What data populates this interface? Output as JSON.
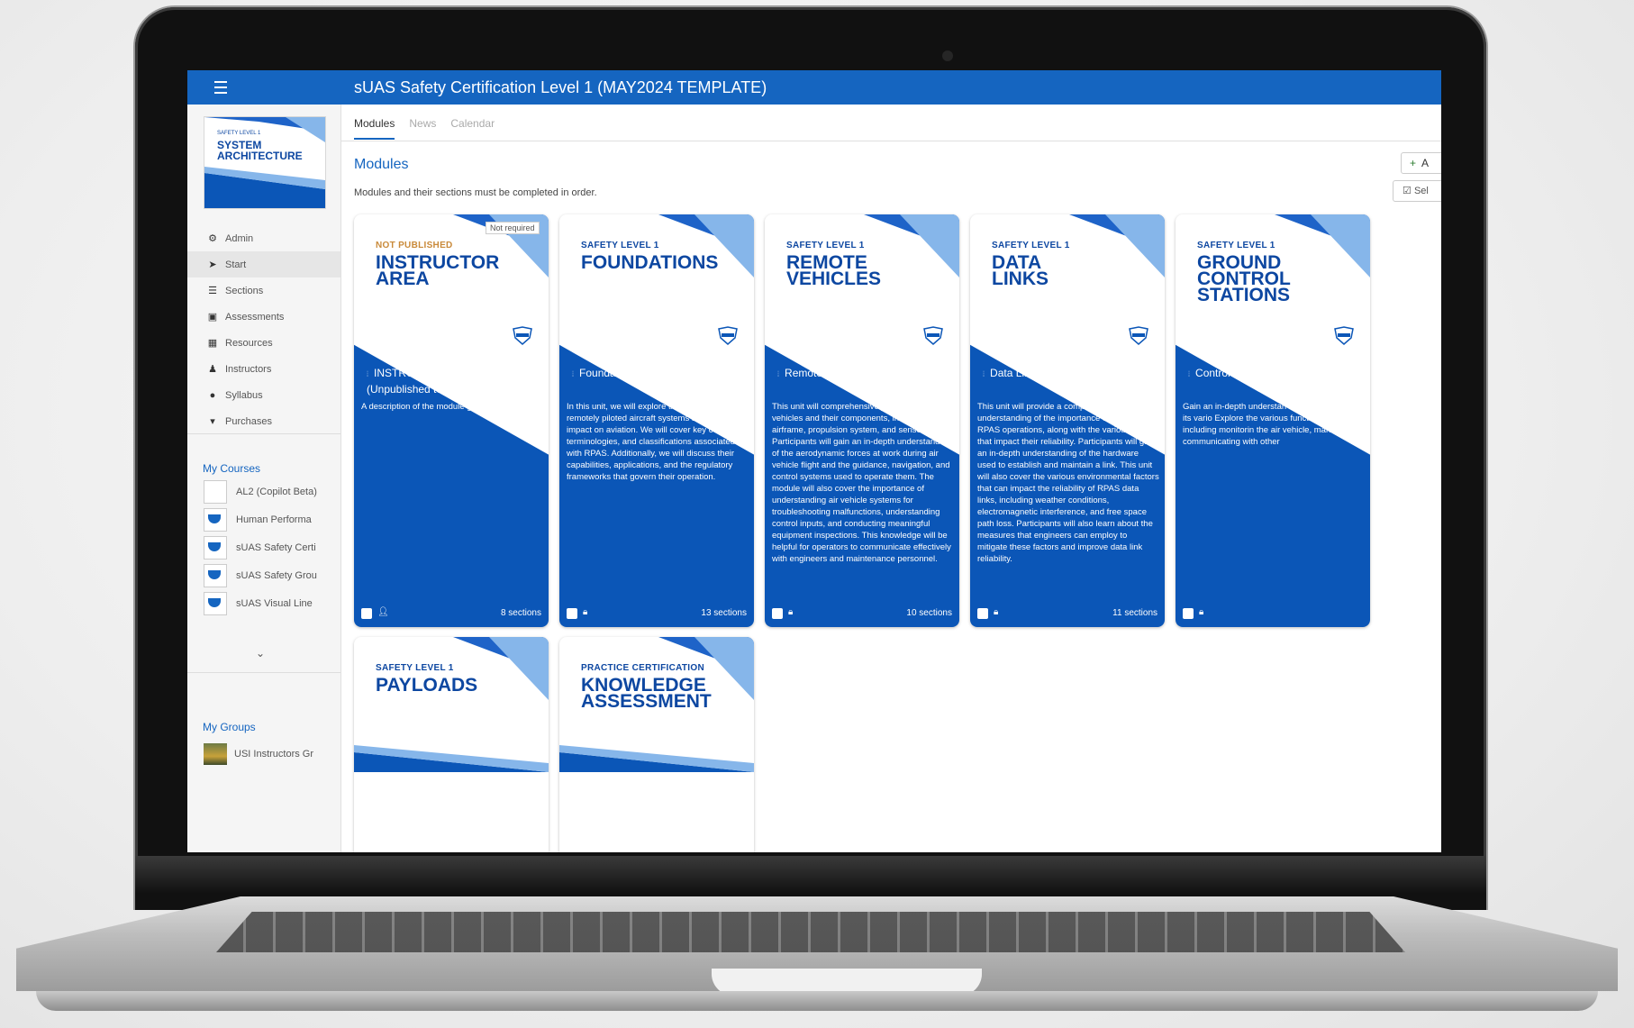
{
  "app": {
    "title": "sUAS Safety Certification Level 1 (MAY2024 TEMPLATE)"
  },
  "course_logo": {
    "kicker": "SAFETY LEVEL 1",
    "title": "SYSTEM ARCHITECTURE"
  },
  "sidebar": {
    "items": [
      {
        "label": "Admin",
        "icon": "gear-icon"
      },
      {
        "label": "Start",
        "icon": "send-icon"
      },
      {
        "label": "Sections",
        "icon": "list-icon"
      },
      {
        "label": "Assessments",
        "icon": "clipboard-icon"
      },
      {
        "label": "Resources",
        "icon": "grid-icon"
      },
      {
        "label": "Instructors",
        "icon": "users-icon"
      },
      {
        "label": "Syllabus",
        "icon": "info-icon"
      },
      {
        "label": "Purchases",
        "icon": "cart-icon"
      }
    ],
    "my_courses_label": "My Courses",
    "courses": [
      {
        "label": "AL2 (Copilot Beta)"
      },
      {
        "label": "Human Performa"
      },
      {
        "label": "sUAS Safety Certi"
      },
      {
        "label": "sUAS Safety Grou"
      },
      {
        "label": "sUAS Visual Line"
      }
    ],
    "my_groups_label": "My Groups",
    "groups": [
      {
        "label": "USI Instructors Gr"
      }
    ]
  },
  "tabs": [
    {
      "label": "Modules"
    },
    {
      "label": "News"
    },
    {
      "label": "Calendar"
    }
  ],
  "main": {
    "title": "Modules",
    "info": "Modules and their sections must be completed in order.",
    "add_label": "A",
    "select_label": "Sel"
  },
  "cards": [
    {
      "kicker": "NOT PUBLISHED",
      "headline": "INSTRUCTOR\nAREA",
      "badge": "Not required",
      "section_title": "INSTRUCTOR ONLY (Unpublished to Students)",
      "description": "A description of the module goes here.",
      "sections": "8 sections",
      "footer_icon": "person-icon"
    },
    {
      "kicker": "SAFETY LEVEL 1",
      "headline": "FOUNDATIONS",
      "section_title": "Foundations",
      "description": "In this unit, we will explore the foundations of remotely piloted aircraft systems and their impact on aviation. We will cover key concepts, terminologies, and classifications associated with RPAS. Additionally, we will discuss their capabilities, applications, and the regulatory frameworks that govern their operation.",
      "sections": "13 sections",
      "footer_icon": "lock-icon"
    },
    {
      "kicker": "SAFETY LEVEL 1",
      "headline": "REMOTE\nVEHICLES",
      "section_title": "Remote Vehicles",
      "description": "This unit will comprehensively understand air vehicles and their components, including the airframe, propulsion system, and sensors. Participants will gain an in-depth understanding of the aerodynamic forces at work during air vehicle flight and the guidance, navigation, and control systems used to operate them. The module will also cover the importance of understanding air vehicle systems for troubleshooting malfunctions, understanding control inputs, and conducting meaningful equipment inspections. This knowledge will be helpful for operators to communicate effectively with engineers and maintenance personnel.",
      "sections": "10 sections",
      "footer_icon": "lock-icon"
    },
    {
      "kicker": "SAFETY LEVEL 1",
      "headline": "DATA\nLINKS",
      "section_title": "Data Links",
      "description": "This unit will provide a comprehensive understanding of the importance of data links in RPAS operations, along with the various factors that impact their reliability. Participants will gain an in-depth understanding of the hardware used to establish and maintain a link. This unit will also cover the various environmental factors that can impact the reliability of RPAS data links, including weather conditions, electromagnetic interference, and free space path loss. Participants will also learn about the measures that engineers can employ to mitigate these factors and improve data link reliability.",
      "sections": "11 sections",
      "footer_icon": "lock-icon"
    },
    {
      "kicker": "SAFETY LEVEL 1",
      "headline": "GROUND\nCONTROL\nSTATIONS",
      "section_title": "Control Stations",
      "description": "Gain an in-depth understan control station and its vario Explore the various functio station, including monitorin the air vehicle, managing d communicating with other",
      "sections": "",
      "footer_icon": "lock-icon"
    },
    {
      "kicker": "SAFETY LEVEL 1",
      "headline": "PAYLOADS"
    },
    {
      "kicker": "PRACTICE CERTIFICATION",
      "headline": "KNOWLEDGE\nASSESSMENT"
    }
  ],
  "colors": {
    "topbar": "#1565c0",
    "card_blue": "#0b56b7",
    "heading_blue": "#0d47a1",
    "not_published": "#c98a3a"
  }
}
